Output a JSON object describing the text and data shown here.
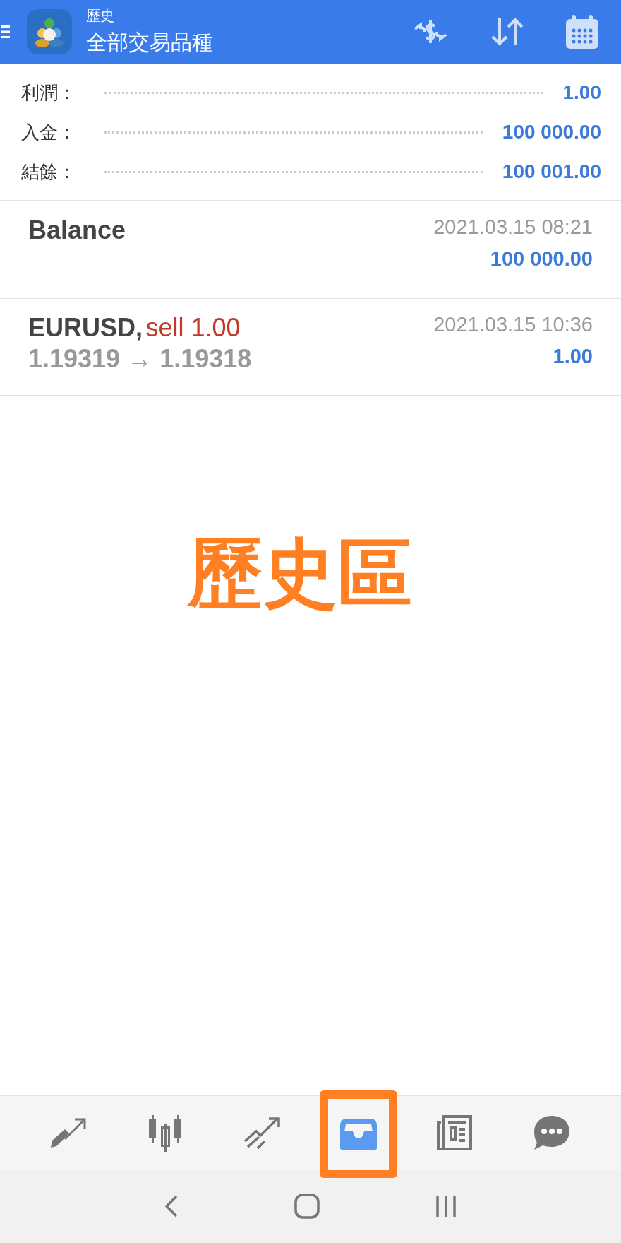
{
  "header": {
    "title": "歷史",
    "subtitle": "全部交易品種",
    "actions": [
      {
        "kind": "currency"
      },
      {
        "kind": "sort"
      },
      {
        "kind": "calendar"
      }
    ]
  },
  "summary": [
    {
      "label": "利潤：",
      "value": "1.00"
    },
    {
      "label": "入金：",
      "value": "100 000.00"
    },
    {
      "label": "結餘：",
      "value": "100 001.00"
    }
  ],
  "deals": [
    {
      "kind": "balance",
      "name": "Balance",
      "time": "2021.03.15 08:21",
      "amount": "100 000.00"
    },
    {
      "kind": "trade",
      "name": "EURUSD,",
      "side": "sell 1.00",
      "prices": "1.19319 → 1.19318",
      "time": "2021.03.15 10:36",
      "amount": "1.00"
    }
  ],
  "annotation": {
    "text": "歷史區"
  },
  "tabs": [
    {
      "kind": "trade",
      "selected": false
    },
    {
      "kind": "quotes",
      "selected": false
    },
    {
      "kind": "chart",
      "selected": false
    },
    {
      "kind": "history",
      "selected": true
    },
    {
      "kind": "news",
      "selected": false
    },
    {
      "kind": "chat",
      "selected": false
    }
  ],
  "system_nav": [
    {
      "kind": "back"
    },
    {
      "kind": "home"
    },
    {
      "kind": "recents"
    }
  ]
}
